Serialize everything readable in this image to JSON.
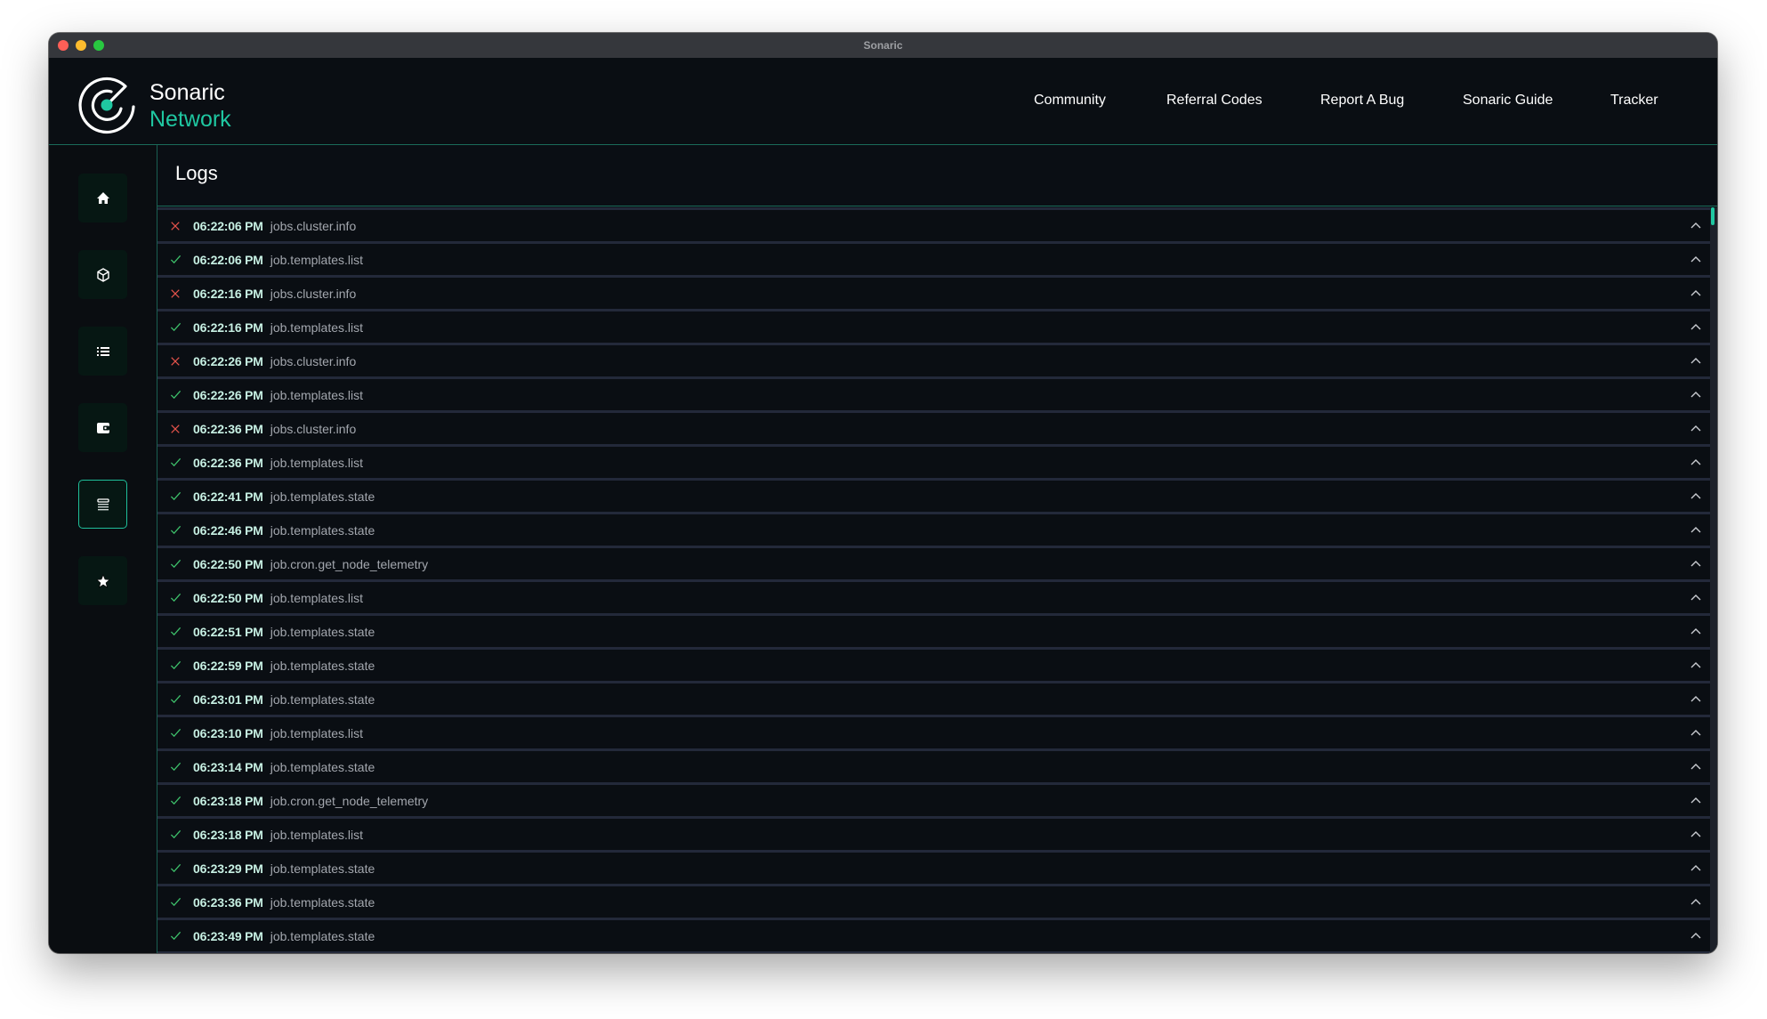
{
  "window": {
    "title": "Sonaric"
  },
  "brand": {
    "line1": "Sonaric",
    "line2": "Network",
    "accent": "#1fc7a1"
  },
  "nav": [
    {
      "label": "Community"
    },
    {
      "label": "Referral Codes"
    },
    {
      "label": "Report A Bug"
    },
    {
      "label": "Sonaric Guide"
    },
    {
      "label": "Tracker"
    }
  ],
  "sidebar": {
    "items": [
      {
        "icon": "home-icon",
        "active": false
      },
      {
        "icon": "cube-icon",
        "active": false
      },
      {
        "icon": "list-icon",
        "active": false
      },
      {
        "icon": "wallet-icon",
        "active": false
      },
      {
        "icon": "logs-icon",
        "active": true
      },
      {
        "icon": "star-icon",
        "active": false
      }
    ]
  },
  "logs": {
    "title": "Logs",
    "status_colors": {
      "success": "#3dbf6a",
      "error": "#e5534b"
    },
    "entries": [
      {
        "status": "error",
        "time": "06:22:06 PM",
        "event": "jobs.cluster.info"
      },
      {
        "status": "success",
        "time": "06:22:06 PM",
        "event": "job.templates.list"
      },
      {
        "status": "error",
        "time": "06:22:16 PM",
        "event": "jobs.cluster.info"
      },
      {
        "status": "success",
        "time": "06:22:16 PM",
        "event": "job.templates.list"
      },
      {
        "status": "error",
        "time": "06:22:26 PM",
        "event": "jobs.cluster.info"
      },
      {
        "status": "success",
        "time": "06:22:26 PM",
        "event": "job.templates.list"
      },
      {
        "status": "error",
        "time": "06:22:36 PM",
        "event": "jobs.cluster.info"
      },
      {
        "status": "success",
        "time": "06:22:36 PM",
        "event": "job.templates.list"
      },
      {
        "status": "success",
        "time": "06:22:41 PM",
        "event": "job.templates.state"
      },
      {
        "status": "success",
        "time": "06:22:46 PM",
        "event": "job.templates.state"
      },
      {
        "status": "success",
        "time": "06:22:50 PM",
        "event": "job.cron.get_node_telemetry"
      },
      {
        "status": "success",
        "time": "06:22:50 PM",
        "event": "job.templates.list"
      },
      {
        "status": "success",
        "time": "06:22:51 PM",
        "event": "job.templates.state"
      },
      {
        "status": "success",
        "time": "06:22:59 PM",
        "event": "job.templates.state"
      },
      {
        "status": "success",
        "time": "06:23:01 PM",
        "event": "job.templates.state"
      },
      {
        "status": "success",
        "time": "06:23:10 PM",
        "event": "job.templates.list"
      },
      {
        "status": "success",
        "time": "06:23:14 PM",
        "event": "job.templates.state"
      },
      {
        "status": "success",
        "time": "06:23:18 PM",
        "event": "job.cron.get_node_telemetry"
      },
      {
        "status": "success",
        "time": "06:23:18 PM",
        "event": "job.templates.list"
      },
      {
        "status": "success",
        "time": "06:23:29 PM",
        "event": "job.templates.state"
      },
      {
        "status": "success",
        "time": "06:23:36 PM",
        "event": "job.templates.state"
      },
      {
        "status": "success",
        "time": "06:23:49 PM",
        "event": "job.templates.state"
      }
    ]
  }
}
